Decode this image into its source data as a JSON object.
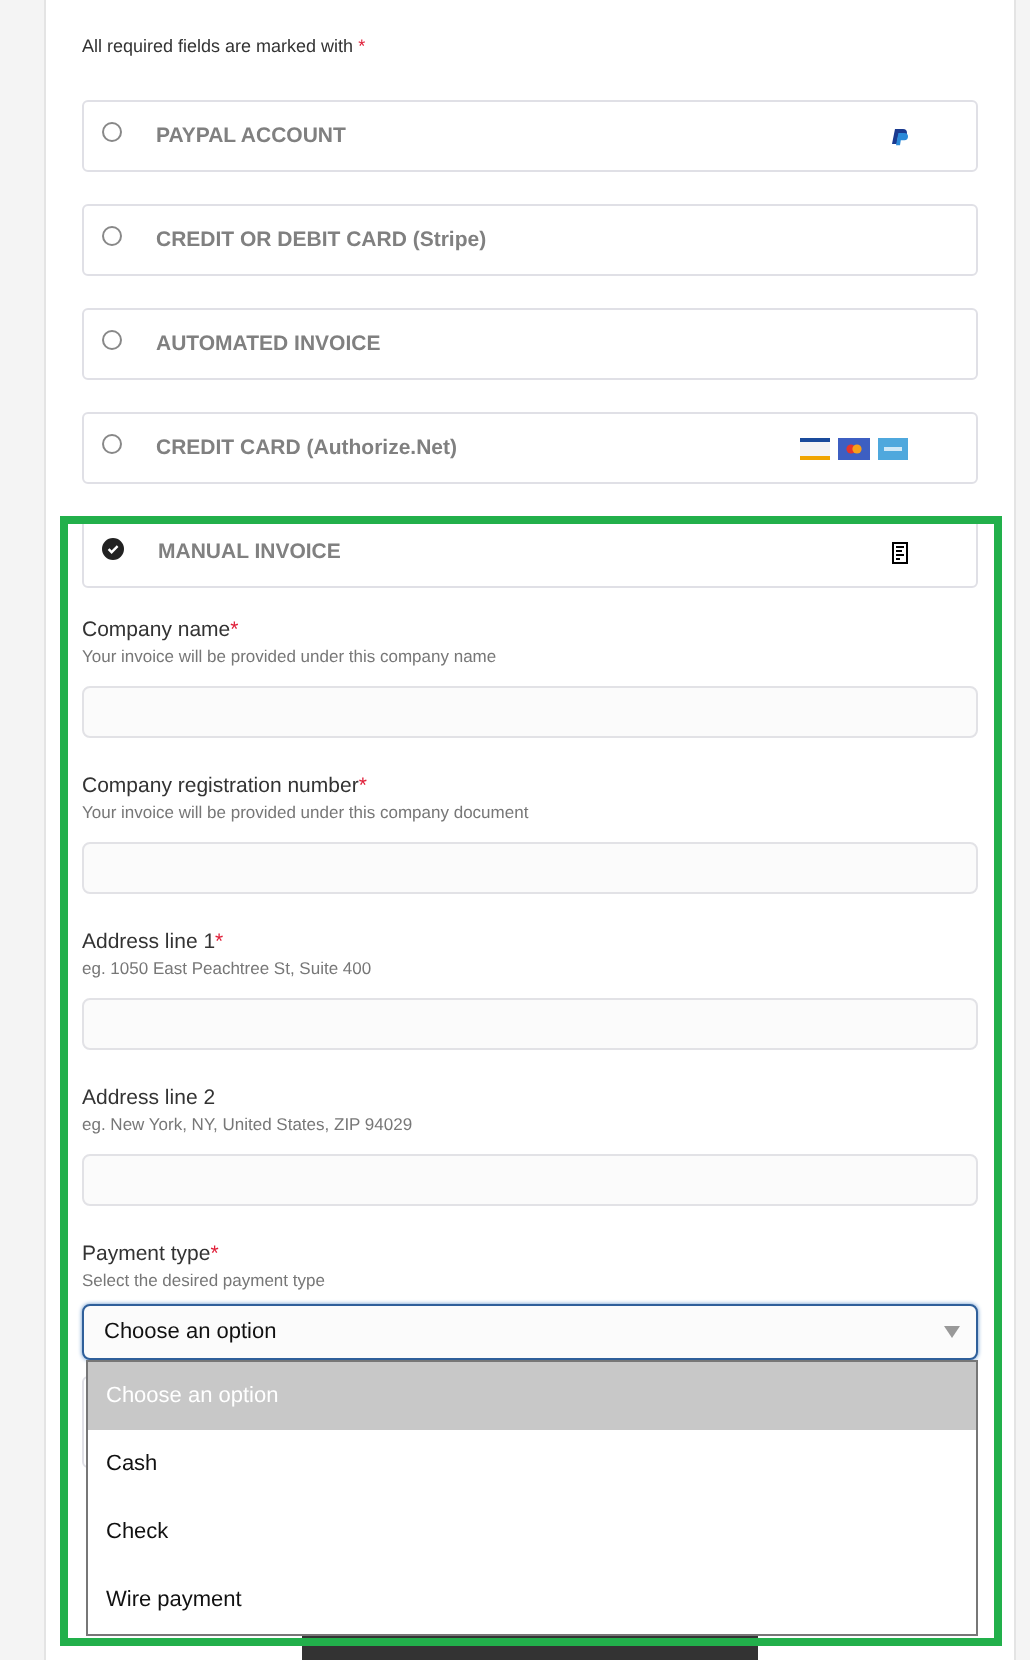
{
  "intro": {
    "text": "All required fields are marked with",
    "required_mark": "*"
  },
  "payment_methods": [
    {
      "label": "PAYPAL ACCOUNT",
      "selected": false,
      "kind": "paypal"
    },
    {
      "label": "CREDIT OR DEBIT CARD (Stripe)",
      "selected": false,
      "kind": "plain"
    },
    {
      "label": "AUTOMATED INVOICE",
      "selected": false,
      "kind": "plain"
    },
    {
      "label": "CREDIT CARD (Authorize.Net)",
      "selected": false,
      "kind": "cards"
    },
    {
      "label": "MANUAL INVOICE",
      "selected": true,
      "kind": "invoice"
    }
  ],
  "fields": [
    {
      "label": "Company name",
      "required_mark": "*",
      "hint": "Your invoice will be provided under this company name"
    },
    {
      "label": "Company registration number",
      "required_mark": "*",
      "hint": "Your invoice will be provided under this company document"
    },
    {
      "label": "Address line 1",
      "required_mark": "*",
      "hint": "eg. 1050 East Peachtree St, Suite 400"
    },
    {
      "label": "Address line 2",
      "hint": "eg. New York, NY, United States, ZIP 94029"
    }
  ],
  "payment_type": {
    "label": "Payment type",
    "required_mark": "*",
    "hint": "Select the desired payment type",
    "value": "Choose an option",
    "expanded": true,
    "options": [
      {
        "label": "Choose an option",
        "highlighted": true
      },
      {
        "label": "Cash",
        "highlighted": false
      },
      {
        "label": "Check",
        "highlighted": false
      },
      {
        "label": "Wire payment",
        "highlighted": false
      }
    ]
  }
}
